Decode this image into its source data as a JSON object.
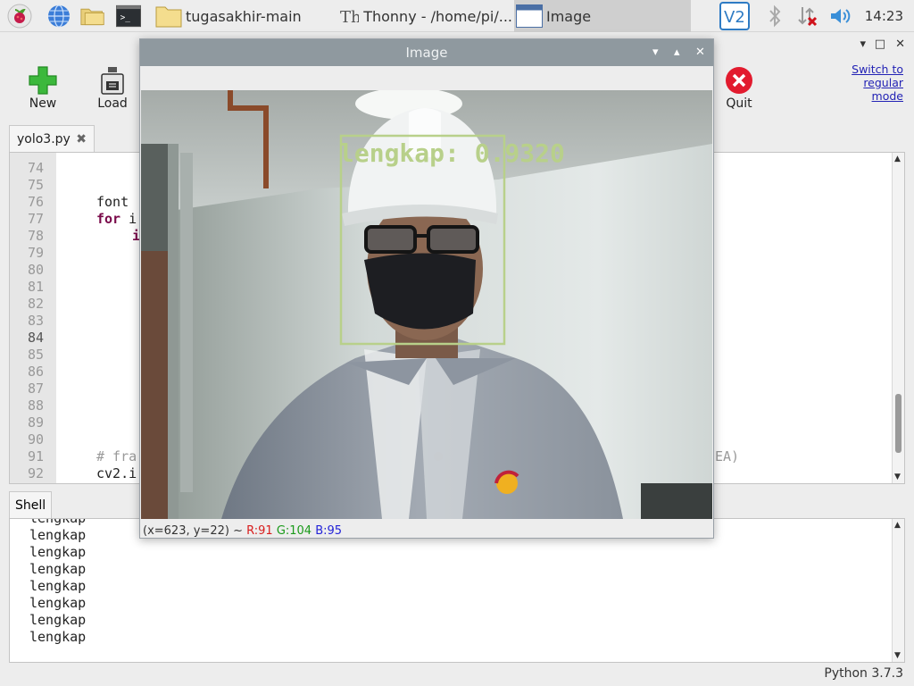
{
  "taskbar": {
    "tasks": [
      {
        "label": "tugasakhir-main",
        "icon": "folder-icon"
      },
      {
        "label": "Thonny  -  /home/pi/...",
        "icon": "thonny-icon"
      },
      {
        "label": "Image",
        "icon": "window-icon"
      }
    ],
    "clock": "14:23",
    "tray_icons": [
      "vnc-icon",
      "bluetooth-icon",
      "network-disconnected-icon",
      "volume-icon"
    ]
  },
  "thonny": {
    "toolbar": {
      "new_label": "New",
      "load_label": "Load",
      "quit_label": "Quit"
    },
    "switch_mode_label": "Switch to regular mode",
    "file_tab": "yolo3.py",
    "line_numbers": [
      "74",
      "75",
      "76",
      "77",
      "78",
      "79",
      "80",
      "81",
      "82",
      "83",
      "84",
      "85",
      "86",
      "87",
      "88",
      "89",
      "90",
      "91",
      "92"
    ],
    "current_line": "84",
    "code": {
      "l76": "font",
      "l77_kw": "for",
      "l77_rest": " i",
      "l78": "i",
      "l91_comment": "# fra",
      "l91_tail": "EA)",
      "l92": "cv2.i"
    },
    "shell_tab": "Shell",
    "shell_lines": [
      "lengkap",
      "lengkap",
      "lengkap",
      "lengkap",
      "lengkap",
      "lengkap",
      "lengkap",
      "lengkap"
    ],
    "status": "Python 3.7.3"
  },
  "image_window": {
    "title": "Image",
    "detection_label": "lengkap: 0.9320",
    "pixel_info": {
      "coords": "(x=623, y=22) ~",
      "r": "R:91",
      "g": "G:104",
      "b": "B:95"
    },
    "box_color": "#b8d08a"
  }
}
